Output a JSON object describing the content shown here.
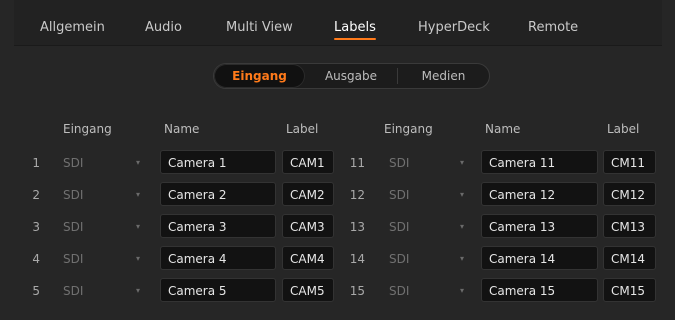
{
  "tabs": [
    {
      "label": "Allgemein",
      "active": false
    },
    {
      "label": "Audio",
      "active": false
    },
    {
      "label": "Multi View",
      "active": false
    },
    {
      "label": "Labels",
      "active": true
    },
    {
      "label": "HyperDeck",
      "active": false
    },
    {
      "label": "Remote",
      "active": false
    }
  ],
  "segments": [
    {
      "label": "Eingang",
      "active": true
    },
    {
      "label": "Ausgabe",
      "active": false
    },
    {
      "label": "Medien",
      "active": false
    }
  ],
  "columns": {
    "left": {
      "input": "Eingang",
      "name": "Name",
      "label": "Label"
    },
    "right": {
      "input": "Eingang",
      "name": "Name",
      "label": "Label"
    }
  },
  "rows_left": [
    {
      "num": "1",
      "source": "SDI",
      "name": "Camera 1",
      "label": "CAM1"
    },
    {
      "num": "2",
      "source": "SDI",
      "name": "Camera 2",
      "label": "CAM2"
    },
    {
      "num": "3",
      "source": "SDI",
      "name": "Camera 3",
      "label": "CAM3"
    },
    {
      "num": "4",
      "source": "SDI",
      "name": "Camera 4",
      "label": "CAM4"
    },
    {
      "num": "5",
      "source": "SDI",
      "name": "Camera 5",
      "label": "CAM5"
    }
  ],
  "rows_right": [
    {
      "num": "11",
      "source": "SDI",
      "name": "Camera 11",
      "label": "CM11"
    },
    {
      "num": "12",
      "source": "SDI",
      "name": "Camera 12",
      "label": "CM12"
    },
    {
      "num": "13",
      "source": "SDI",
      "name": "Camera 13",
      "label": "CM13"
    },
    {
      "num": "14",
      "source": "SDI",
      "name": "Camera 14",
      "label": "CM14"
    },
    {
      "num": "15",
      "source": "SDI",
      "name": "Camera 15",
      "label": "CM15"
    }
  ],
  "colors": {
    "accent": "#ff7a1a",
    "background": "#262626",
    "field": "#121212"
  },
  "icons": {
    "dropdown": "chevron-down-icon"
  }
}
